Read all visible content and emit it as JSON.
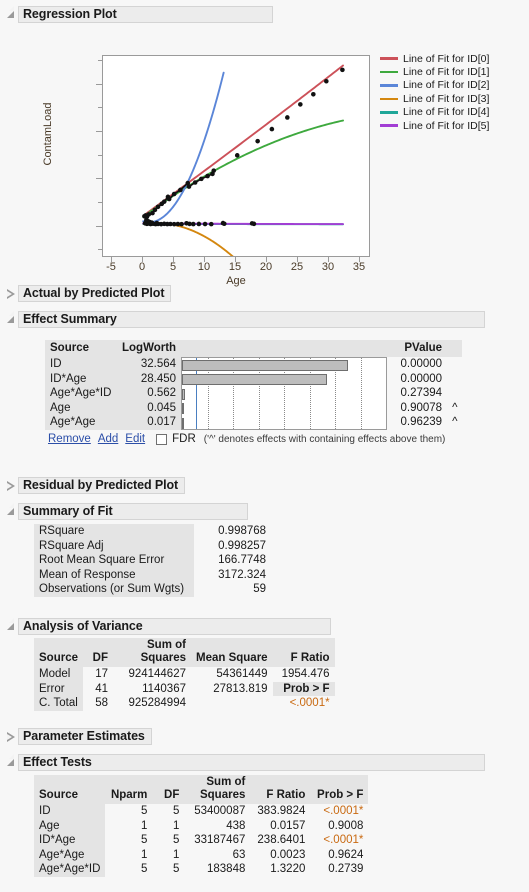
{
  "sections": [
    {
      "id": "regression-plot",
      "title": "Regression Plot",
      "state": "expanded"
    },
    {
      "id": "actual-by-predicted-plot",
      "title": "Actual by Predicted Plot",
      "state": "collapsed"
    },
    {
      "id": "effect-summary",
      "title": "Effect Summary",
      "state": "expanded"
    },
    {
      "id": "residual-by-predicted-plot",
      "title": "Residual by Predicted Plot",
      "state": "collapsed"
    },
    {
      "id": "summary-of-fit",
      "title": "Summary of Fit",
      "state": "expanded"
    },
    {
      "id": "analysis-of-variance",
      "title": "Analysis of Variance",
      "state": "expanded"
    },
    {
      "id": "parameter-estimates",
      "title": "Parameter Estimates",
      "state": "collapsed"
    },
    {
      "id": "effect-tests",
      "title": "Effect Tests",
      "state": "expanded"
    }
  ],
  "chart_data": {
    "type": "scatter",
    "title": "Regression Plot",
    "xlabel": "Age",
    "ylabel": "ContamLoad",
    "xlim": [
      -6.5,
      36.5
    ],
    "ylim": [
      -3300,
      17600
    ],
    "xticks": [
      -5,
      0,
      5,
      10,
      15,
      20,
      25,
      30,
      35
    ],
    "yticks": [
      0,
      5000,
      10000,
      15000
    ],
    "grid": false,
    "legend_position": "right",
    "series": [
      {
        "name": "Line of Fit for ID[0]",
        "color": "#cc5159",
        "kind": "quadratic",
        "coef": [
          900,
          470,
          0.5
        ],
        "xrange": [
          0,
          32.3
        ]
      },
      {
        "name": "Line of Fit for ID[1]",
        "color": "#3ea93e",
        "kind": "quadratic",
        "coef": [
          780,
          480,
          -5.2
        ],
        "xrange": [
          0,
          32.3
        ]
      },
      {
        "name": "Line of Fit for ID[2]",
        "color": "#5b86d8",
        "kind": "quadratic",
        "coef": [
          330,
          -210,
          108
        ],
        "xrange": [
          0,
          13.0
        ]
      },
      {
        "name": "Line of Fit for ID[3]",
        "color": "#d4870f",
        "kind": "quadratic",
        "coef": [
          60,
          90,
          -22.5
        ],
        "xrange": [
          0,
          14.5
        ]
      },
      {
        "name": "Line of Fit for ID[4]",
        "color": "#1fa698",
        "kind": "quadratic",
        "coef": [
          60,
          -2,
          0.02
        ],
        "xrange": [
          0,
          32.3
        ]
      },
      {
        "name": "Line of Fit for ID[5]",
        "color": "#a23ed4",
        "kind": "quadratic",
        "coef": [
          110,
          -4,
          0.05
        ],
        "xrange": [
          0,
          32.3
        ]
      }
    ],
    "points": [
      [
        0.2,
        850
      ],
      [
        0.4,
        940
      ],
      [
        0.6,
        790
      ],
      [
        0.9,
        1050
      ],
      [
        1.5,
        1180
      ],
      [
        1.9,
        1520
      ],
      [
        2.4,
        1840
      ],
      [
        3.0,
        2150
      ],
      [
        3.4,
        2380
      ],
      [
        4.0,
        2880
      ],
      [
        4.2,
        2650
      ],
      [
        5.0,
        3180
      ],
      [
        6.0,
        3600
      ],
      [
        7.2,
        4320
      ],
      [
        7.4,
        3950
      ],
      [
        8.4,
        4380
      ],
      [
        9.4,
        4760
      ],
      [
        10.4,
        5050
      ],
      [
        11.4,
        5620
      ],
      [
        11.2,
        5280
      ],
      [
        15.2,
        7220
      ],
      [
        18.5,
        8700
      ],
      [
        20.8,
        9960
      ],
      [
        23.3,
        11180
      ],
      [
        25.4,
        12540
      ],
      [
        27.5,
        13600
      ],
      [
        29.6,
        14960
      ],
      [
        32.2,
        16150
      ],
      [
        0.3,
        120
      ],
      [
        0.6,
        60
      ],
      [
        0.9,
        95
      ],
      [
        1.2,
        40
      ],
      [
        1.6,
        70
      ],
      [
        2.0,
        30
      ],
      [
        2.4,
        55
      ],
      [
        2.9,
        25
      ],
      [
        3.4,
        60
      ],
      [
        3.9,
        35
      ],
      [
        4.4,
        45
      ],
      [
        5.0,
        25
      ],
      [
        5.6,
        40
      ],
      [
        6.2,
        30
      ],
      [
        7.0,
        120
      ],
      [
        7.5,
        55
      ],
      [
        8.1,
        35
      ],
      [
        9.0,
        50
      ],
      [
        10.0,
        40
      ],
      [
        11.0,
        30
      ],
      [
        12.9,
        140
      ],
      [
        13.1,
        70
      ],
      [
        17.6,
        110
      ],
      [
        17.9,
        60
      ],
      [
        0.5,
        430
      ],
      [
        0.8,
        330
      ],
      [
        1.1,
        240
      ],
      [
        1.4,
        180
      ],
      [
        2.2,
        150
      ]
    ]
  },
  "effect_summary": {
    "columns": [
      "Source",
      "LogWorth",
      "",
      "PValue",
      ""
    ],
    "rows": [
      {
        "source": "ID",
        "logworth": "32.564",
        "bar": 32.564,
        "pvalue": "0.00000",
        "caret": ""
      },
      {
        "source": "ID*Age",
        "logworth": "28.450",
        "bar": 28.45,
        "pvalue": "0.00000",
        "caret": ""
      },
      {
        "source": "Age*Age*ID",
        "logworth": "0.562",
        "bar": 0.562,
        "pvalue": "0.27394",
        "caret": ""
      },
      {
        "source": "Age",
        "logworth": "0.045",
        "bar": 0.045,
        "pvalue": "0.90078",
        "caret": "^"
      },
      {
        "source": "Age*Age",
        "logworth": "0.017",
        "bar": 0.017,
        "pvalue": "0.96239",
        "caret": "^"
      }
    ],
    "bar_max": 40,
    "threshold": 2.0,
    "threshold_color": "#4a7fc1",
    "links": {
      "remove": "Remove",
      "add": "Add",
      "edit": "Edit"
    },
    "fdr_label": "FDR",
    "fdr_checked": false,
    "note": "('^' denotes effects with containing effects above them)"
  },
  "summary_of_fit": {
    "rows": [
      {
        "label": "RSquare",
        "value": "0.998768"
      },
      {
        "label": "RSquare Adj",
        "value": "0.998257"
      },
      {
        "label": "Root Mean Square Error",
        "value": "166.7748"
      },
      {
        "label": "Mean of Response",
        "value": "3172.324"
      },
      {
        "label": "Observations (or Sum Wgts)",
        "value": "59"
      }
    ]
  },
  "analysis_of_variance": {
    "columns": [
      "Source",
      "DF",
      "Sum of Squares",
      "Mean Square",
      "F Ratio"
    ],
    "rows": [
      {
        "source": "Model",
        "df": "17",
        "ss": "924144627",
        "ms": "54361449",
        "f": "1954.476"
      },
      {
        "source": "Error",
        "df": "41",
        "ss": "1140367",
        "ms": "27813.819",
        "f": "Prob > F"
      },
      {
        "source": "C. Total",
        "df": "58",
        "ss": "925284994",
        "ms": "",
        "f": "<.0001*"
      }
    ],
    "prob_label": "Prob > F",
    "prob_value": "<.0001*"
  },
  "effect_tests": {
    "columns": [
      "Source",
      "Nparm",
      "DF",
      "Sum of Squares",
      "F Ratio",
      "Prob > F"
    ],
    "rows": [
      {
        "source": "ID",
        "nparm": "5",
        "df": "5",
        "ss": "53400087",
        "f": "383.9824",
        "p": "<.0001*",
        "sig": true
      },
      {
        "source": "Age",
        "nparm": "1",
        "df": "1",
        "ss": "438",
        "f": "0.0157",
        "p": "0.9008",
        "sig": false
      },
      {
        "source": "ID*Age",
        "nparm": "5",
        "df": "5",
        "ss": "33187467",
        "f": "238.6401",
        "p": "<.0001*",
        "sig": true
      },
      {
        "source": "Age*Age",
        "nparm": "1",
        "df": "1",
        "ss": "63",
        "f": "0.0023",
        "p": "0.9624",
        "sig": false
      },
      {
        "source": "Age*Age*ID",
        "nparm": "5",
        "df": "5",
        "ss": "183848",
        "f": "1.3220",
        "p": "0.2739",
        "sig": false
      }
    ]
  },
  "colors": {
    "header_bg": "#ececec",
    "table_header_bg": "#e4e4e4",
    "significant": "#c96a12",
    "link": "#2b4ea8",
    "axis_text": "#4a3b28"
  }
}
